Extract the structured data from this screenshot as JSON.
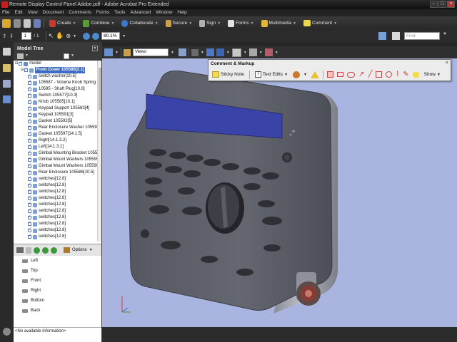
{
  "window": {
    "title": "Remote Display Control Panel Adobe.pdf - Adobe Acrobat Pro Extended"
  },
  "menu": [
    "File",
    "Edit",
    "View",
    "Document",
    "Comments",
    "Forms",
    "Tools",
    "Advanced",
    "Window",
    "Help"
  ],
  "toolbar": {
    "create": "Create",
    "combine": "Combine",
    "collaborate": "Collaborate",
    "secure": "Secure",
    "sign": "Sign",
    "forms": "Forms",
    "multimedia": "Multimedia",
    "comment": "Comment"
  },
  "nav": {
    "page_number": "1",
    "page_total": "/ 1",
    "zoom": "80.1%",
    "find_placeholder": "Find"
  },
  "model_tree": {
    "title": "Model Tree",
    "items": [
      "model",
      "Front Cover 105580[2.1]",
      "switch washer[10.5]",
      "105587 - Volume Knob Spring",
      "10595 - Shaft Plug[10.8]",
      "Switch 105577[10.3]",
      "Knob 105585[10.1]",
      "Keypad Support 105583[4]",
      "Keypad 105591[3]",
      "Gasket 105592[5]",
      "Rear Enclosure Washer 10559",
      "Gasket 105597[14.1.5]",
      "Right[14.1.3.2]",
      "Left[14.1.3.1]",
      "Gimbal Mounting Bracket 1055",
      "Gimbal Mount Washers 105599",
      "Gimbal Mount Washers 105599",
      "Rear Enclosure 105586[10.5]",
      "switches[12.8]",
      "switches[12.8]",
      "switches[12.8]",
      "switches[12.8]",
      "switches[12.8]",
      "switches[12.8]",
      "switches[12.8]",
      "switches[12.8]",
      "switches[12.8]",
      "switches[12.8]"
    ],
    "options": "Options",
    "views": [
      "Left",
      "Top",
      "Front",
      "Right",
      "Bottom",
      "Back"
    ],
    "info": "<No available information>"
  },
  "viewer": {
    "views_dropdown": "Views"
  },
  "comment_markup": {
    "title": "Comment & Markup",
    "sticky_note": "Sticky Note",
    "text_edits": "Text Edits",
    "show": "Show"
  },
  "colors": {
    "viewport_bg": "#a9b4e0",
    "display_blue": "#3a43a8",
    "device_gray": "#5c5f68"
  }
}
